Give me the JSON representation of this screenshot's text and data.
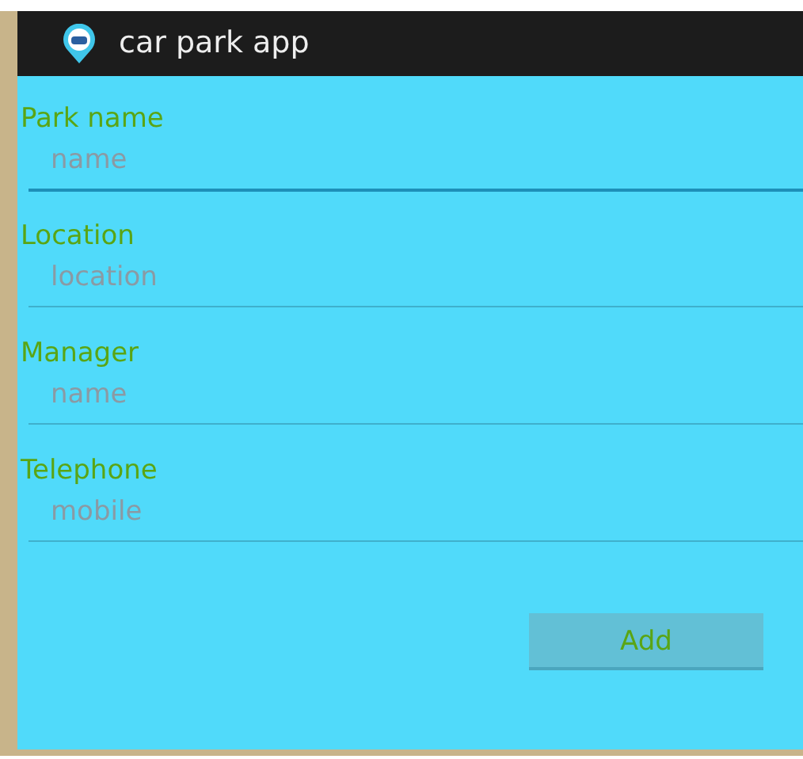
{
  "app_bar": {
    "title": "car park app"
  },
  "fields": [
    {
      "label": "Park name",
      "placeholder": "name",
      "focused": true
    },
    {
      "label": "Location",
      "placeholder": "location",
      "focused": false
    },
    {
      "label": "Manager",
      "placeholder": "name",
      "focused": false
    },
    {
      "label": "Telephone",
      "placeholder": "mobile",
      "focused": false
    }
  ],
  "button": {
    "label": "Add"
  }
}
